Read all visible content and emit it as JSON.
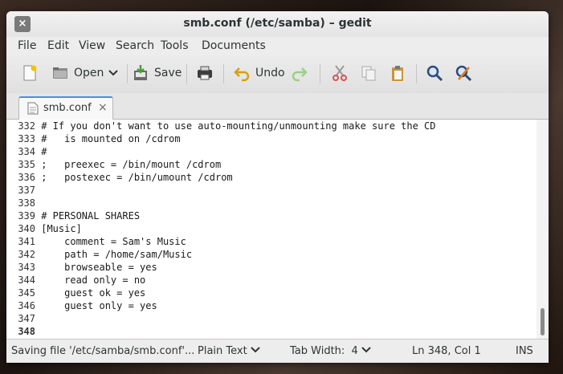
{
  "window": {
    "title": "smb.conf (/etc/samba) – gedit",
    "close_glyph": "×"
  },
  "menu": [
    "File",
    "Edit",
    "View",
    "Search",
    "Tools",
    "Documents"
  ],
  "toolbar": {
    "open_label": "Open",
    "save_label": "Save",
    "undo_label": "Undo",
    "icons": [
      "new-document-icon",
      "open-folder-icon",
      "chevron-down-icon",
      "save-icon",
      "print-icon",
      "undo-icon",
      "redo-icon",
      "cut-icon",
      "copy-icon",
      "paste-icon",
      "search-icon",
      "replace-icon"
    ]
  },
  "tab": {
    "label": "smb.conf",
    "close_glyph": "×"
  },
  "editor": {
    "current_line": "348",
    "lines": [
      {
        "n": "332",
        "text": "# If you don't want to use auto-mounting/unmounting make sure the CD"
      },
      {
        "n": "333",
        "text": "#   is mounted on /cdrom"
      },
      {
        "n": "334",
        "text": "#"
      },
      {
        "n": "335",
        "text": ";   preexec = /bin/mount /cdrom"
      },
      {
        "n": "336",
        "text": ";   postexec = /bin/umount /cdrom"
      },
      {
        "n": "337",
        "text": ""
      },
      {
        "n": "338",
        "text": ""
      },
      {
        "n": "339",
        "text": "# PERSONAL SHARES"
      },
      {
        "n": "340",
        "text": "[Music]"
      },
      {
        "n": "341",
        "text": "    comment = Sam's Music"
      },
      {
        "n": "342",
        "text": "    path = /home/sam/Music"
      },
      {
        "n": "343",
        "text": "    browseable = yes"
      },
      {
        "n": "344",
        "text": "    read only = no"
      },
      {
        "n": "345",
        "text": "    guest ok = yes"
      },
      {
        "n": "346",
        "text": "    guest only = yes"
      },
      {
        "n": "347",
        "text": ""
      },
      {
        "n": "348",
        "text": ""
      }
    ]
  },
  "status": {
    "message": "Saving file '/etc/samba/smb.conf'...",
    "language": "Plain Text",
    "tab_width": "Tab Width:  4",
    "position": "Ln 348, Col 1",
    "mode": "INS"
  },
  "colors": {
    "accent": "#4a90d9",
    "window_bg": "#ededed",
    "editor_bg": "#ffffff"
  }
}
